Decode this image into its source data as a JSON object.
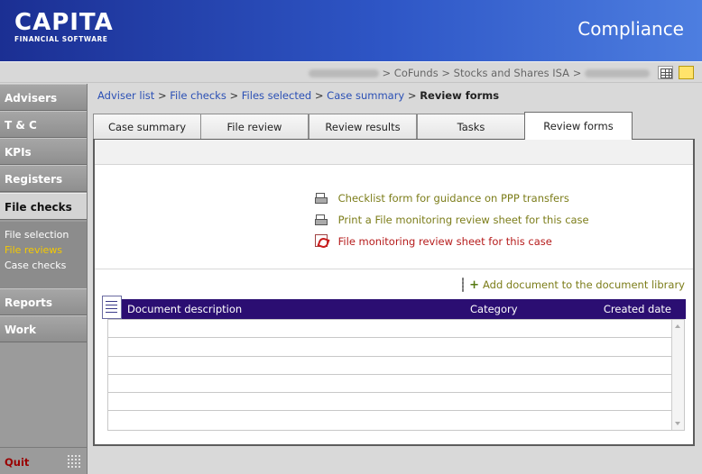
{
  "header": {
    "brand": "CAPITA",
    "brand_sub": "FINANCIAL SOFTWARE",
    "app_title": "Compliance"
  },
  "pathbar": {
    "sep": ">",
    "item2": "CoFunds",
    "item3": "Stocks and Shares ISA"
  },
  "sidebar": {
    "items": [
      {
        "label": "Advisers"
      },
      {
        "label": "T & C"
      },
      {
        "label": "KPIs"
      },
      {
        "label": "Registers"
      },
      {
        "label": "File checks"
      },
      {
        "label": "Reports"
      },
      {
        "label": "Work"
      }
    ],
    "subitems": [
      {
        "label": "File selection"
      },
      {
        "label": "File reviews"
      },
      {
        "label": "Case checks"
      }
    ],
    "quit": "Quit"
  },
  "breadcrumb": {
    "items": [
      "Adviser list",
      "File checks",
      "Files selected",
      "Case summary"
    ],
    "current": "Review forms",
    "sep": ">"
  },
  "tabs": [
    {
      "label": "Case summary"
    },
    {
      "label": "File review"
    },
    {
      "label": "Review results"
    },
    {
      "label": "Tasks"
    },
    {
      "label": "Review forms"
    }
  ],
  "forms": [
    {
      "label": "Checklist form for guidance on PPP transfers",
      "icon": "printer-icon"
    },
    {
      "label": "Print a File monitoring review sheet for this case",
      "icon": "printer-icon"
    },
    {
      "label": "File monitoring review sheet for this case",
      "icon": "pdf-icon"
    }
  ],
  "add_doc": {
    "label": "Add document to the document library",
    "plus": "+"
  },
  "table": {
    "headers": {
      "description": "Document description",
      "category": "Category",
      "created": "Created date"
    },
    "rows": []
  },
  "colors": {
    "header_start": "#1b2f93",
    "header_end": "#4d7ee0",
    "link_olive": "#7c7d1a",
    "link_red": "#b61c1c",
    "table_header": "#2b0e72",
    "subnav_current": "#f5c900"
  }
}
